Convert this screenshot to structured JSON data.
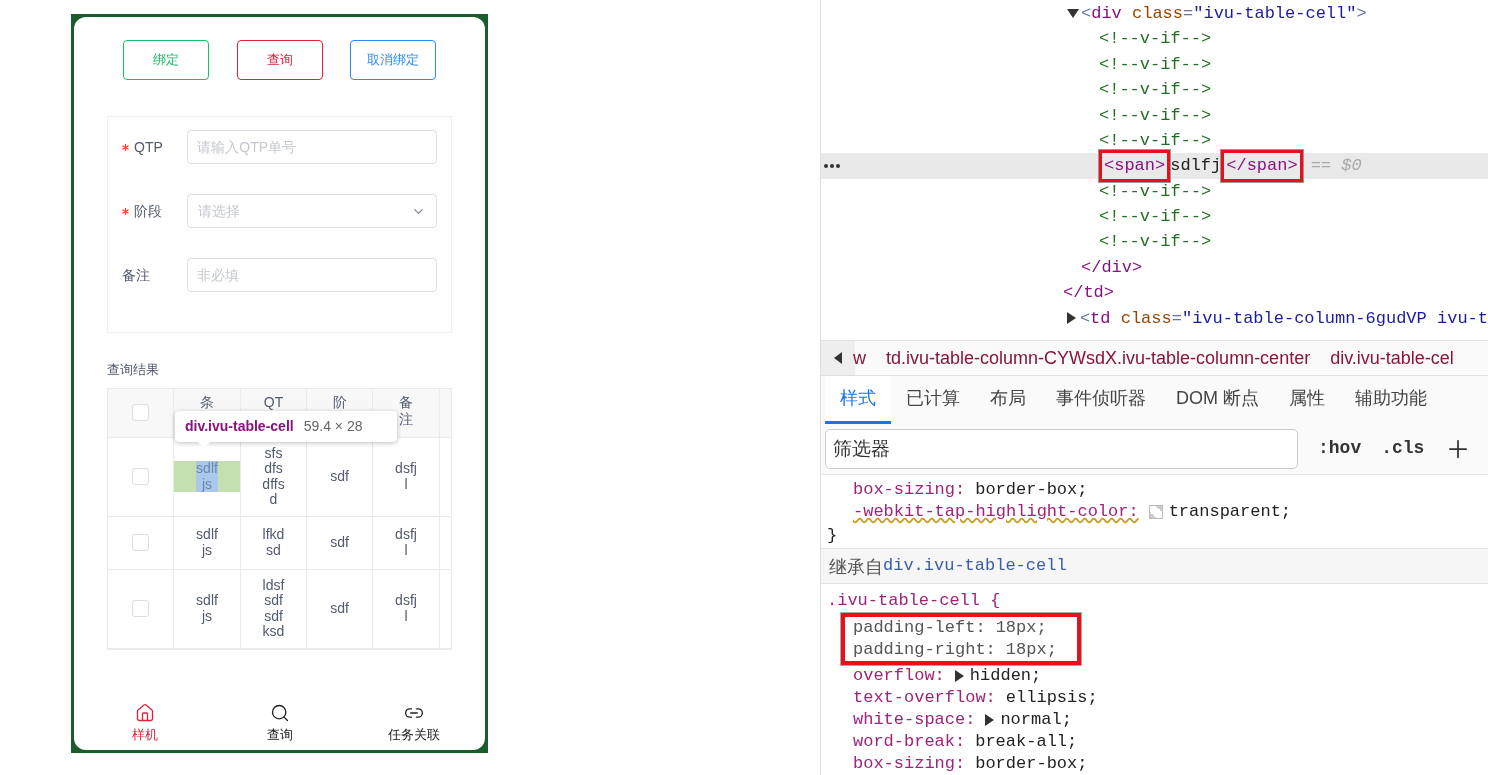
{
  "phone": {
    "buttons": [
      {
        "label": "绑定",
        "kind": "success"
      },
      {
        "label": "查询",
        "kind": "error"
      },
      {
        "label": "取消绑定",
        "kind": "primary"
      }
    ],
    "form": [
      {
        "label": "QTP",
        "required": true,
        "kind": "input",
        "placeholder": "请输入QTP单号"
      },
      {
        "label": "阶段",
        "required": true,
        "kind": "select",
        "placeholder": "请选择"
      },
      {
        "label": "备注",
        "required": false,
        "kind": "input",
        "placeholder": "非必填"
      }
    ],
    "results_title": "查询结果",
    "table": {
      "all_checked": false,
      "columns": [
        "条",
        "QT",
        "阶",
        "备注"
      ],
      "rows": [
        {
          "checked": false,
          "cells": [
            {
              "lines": [
                "sdlf",
                "js"
              ],
              "inspected": true
            },
            {
              "lines": [
                "sfs",
                "dfs",
                "dffs",
                "d"
              ],
              "inspected": false
            },
            {
              "lines": [
                "sdf"
              ],
              "inspected": false
            },
            {
              "lines": [
                "dsfj",
                "l"
              ],
              "inspected": false
            }
          ]
        },
        {
          "checked": false,
          "cells": [
            {
              "lines": [
                "sdlf",
                "js"
              ],
              "inspected": false
            },
            {
              "lines": [
                "lfkd",
                "sd"
              ],
              "inspected": false
            },
            {
              "lines": [
                "sdf"
              ],
              "inspected": false
            },
            {
              "lines": [
                "dsfj",
                "l"
              ],
              "inspected": false
            }
          ]
        },
        {
          "checked": false,
          "cells": [
            {
              "lines": [
                "sdlf",
                "js"
              ],
              "inspected": false
            },
            {
              "lines": [
                "ldsf",
                "sdf",
                "sdf",
                "ksd"
              ],
              "inspected": false
            },
            {
              "lines": [
                "sdf"
              ],
              "inspected": false
            },
            {
              "lines": [
                "dsfj",
                "l"
              ],
              "inspected": false
            }
          ]
        }
      ]
    },
    "tooltip": {
      "selector": "div.ivu-table-cell",
      "size": "59.4 × 28"
    },
    "nav": [
      {
        "label": "样机",
        "selected": true
      },
      {
        "label": "查询",
        "selected": false
      },
      {
        "label": "任务关联",
        "selected": false
      }
    ]
  },
  "devtools": {
    "dom_tree": [
      {
        "selected": false,
        "children": [
          {
            "selected": false,
            "expanded": true,
            "line": [
              {
                "t": "<",
                "kind": "bracket"
              },
              {
                "t": "div",
                "kind": "tag"
              },
              {
                "t": " class",
                "kind": "attr"
              },
              {
                "t": "=",
                "kind": "bracket"
              },
              {
                "t": "\"ivu-table-cell\"",
                "kind": "value"
              },
              {
                "t": ">",
                "kind": "bracket"
              }
            ],
            "children": [
              {
                "selected": false,
                "line": [
                  {
                    "t": "<!--v-if-->",
                    "kind": "comment"
                  }
                ]
              },
              {
                "selected": false,
                "line": [
                  {
                    "t": "<!--v-if-->",
                    "kind": "comment"
                  }
                ]
              },
              {
                "selected": false,
                "line": [
                  {
                    "t": "<!--v-if-->",
                    "kind": "comment"
                  }
                ]
              },
              {
                "selected": false,
                "line": [
                  {
                    "t": "<!--v-if-->",
                    "kind": "comment"
                  }
                ]
              },
              {
                "selected": false,
                "line": [
                  {
                    "t": "<!--v-if-->",
                    "kind": "comment"
                  }
                ]
              },
              {
                "selected": true,
                "line": [
                  {
                    "t": "<span>",
                    "kind": "tag",
                    "boxed": true
                  },
                  {
                    "t": "sdlfj",
                    "kind": "text",
                    "boxed": false
                  },
                  {
                    "t": "</span>",
                    "kind": "tag",
                    "boxed": true
                  },
                  {
                    "t": "== $0",
                    "kind": "hint",
                    "boxed": false
                  }
                ]
              },
              {
                "selected": false,
                "line": [
                  {
                    "t": "<!--v-if-->",
                    "kind": "comment"
                  }
                ]
              },
              {
                "selected": false,
                "line": [
                  {
                    "t": "<!--v-if-->",
                    "kind": "comment"
                  }
                ]
              },
              {
                "selected": false,
                "line": [
                  {
                    "t": "<!--v-if-->",
                    "kind": "comment"
                  }
                ]
              }
            ],
            "close": [
              {
                "t": "</div>",
                "kind": "tag"
              }
            ]
          }
        ],
        "close": [
          {
            "t": "</td>",
            "kind": "tag"
          }
        ]
      },
      {
        "selected": false,
        "expanded": false,
        "line": [
          {
            "t": "<",
            "kind": "bracket"
          },
          {
            "t": "td",
            "kind": "tag"
          },
          {
            "t": " class",
            "kind": "attr"
          },
          {
            "t": "=",
            "kind": "bracket"
          },
          {
            "t": "\"ivu-table-column-6gudVP ivu-t",
            "kind": "value"
          }
        ]
      }
    ],
    "breadcrumbs": [
      "w",
      "td.ivu-table-column-CYWsdX.ivu-table-column-center",
      "div.ivu-table-cel"
    ],
    "tabs": [
      {
        "label": "样式",
        "selected": true
      },
      {
        "label": "已计算",
        "selected": false
      },
      {
        "label": "布局",
        "selected": false
      },
      {
        "label": "事件侦听器",
        "selected": false
      },
      {
        "label": "DOM 断点",
        "selected": false
      },
      {
        "label": "属性",
        "selected": false
      },
      {
        "label": "辅助功能",
        "selected": false
      }
    ],
    "filter": {
      "placeholder": "筛选器",
      "buttons": [
        ":hov",
        ".cls"
      ]
    },
    "blocks": [
      {
        "kind": "rule",
        "props": [
          {
            "name": "box-sizing:",
            "value": "border-box;",
            "boxed": false,
            "warning": false,
            "swatch": false,
            "expandable": false
          },
          {
            "name": "-webkit-tap-highlight-color:",
            "value": "transparent;",
            "boxed": false,
            "warning": true,
            "swatch": true,
            "expandable": false
          }
        ],
        "close": "}"
      },
      {
        "kind": "inherited",
        "label": "继承自",
        "selector": "div.ivu-table-cell"
      },
      {
        "kind": "rule",
        "selector": ".ivu-table-cell {",
        "props": [
          {
            "name": "padding-left:",
            "value": "18px;",
            "boxed": true,
            "warning": false,
            "swatch": false,
            "expandable": false
          },
          {
            "name": "padding-right:",
            "value": "18px;",
            "boxed": true,
            "warning": false,
            "swatch": false,
            "expandable": false
          },
          {
            "name": "overflow:",
            "value": "hidden;",
            "boxed": false,
            "warning": false,
            "swatch": false,
            "expandable": true
          },
          {
            "name": "text-overflow:",
            "value": "ellipsis;",
            "boxed": false,
            "warning": false,
            "swatch": false,
            "expandable": false
          },
          {
            "name": "white-space:",
            "value": "normal;",
            "boxed": false,
            "warning": false,
            "swatch": false,
            "expandable": true
          },
          {
            "name": "word-break:",
            "value": "break-all;",
            "boxed": false,
            "warning": false,
            "swatch": false,
            "expandable": false
          },
          {
            "name": "box-sizing:",
            "value": "border-box;",
            "boxed": false,
            "warning": false,
            "swatch": false,
            "expandable": false
          }
        ]
      }
    ]
  }
}
